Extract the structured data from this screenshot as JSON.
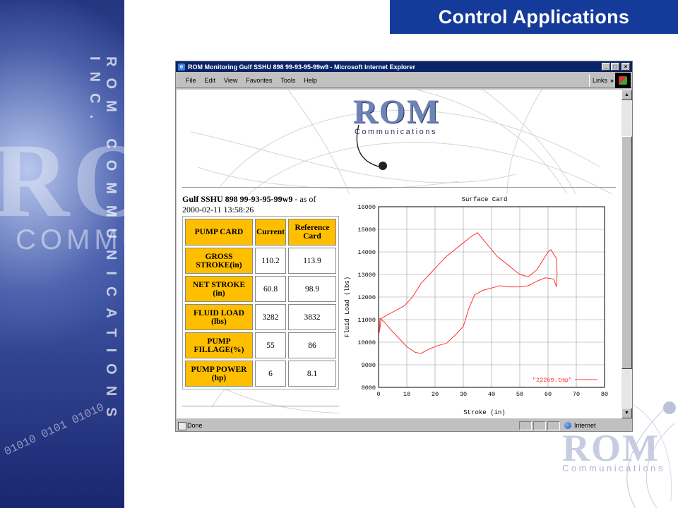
{
  "slide": {
    "title": "Control Applications",
    "left_panel": {
      "big_letters": "ROM",
      "word": "COMMU",
      "vertical_text": "ROM COMMUNICATIONS INC.",
      "binary": "01010 0101 01010"
    },
    "corner_logo": {
      "text": "ROM",
      "sub": "Communications"
    }
  },
  "window": {
    "title": "ROM Monitoring Gulf SSHU 898 99-93-95-99w9 - Microsoft Internet Explorer",
    "menu": [
      "File",
      "Edit",
      "View",
      "Favorites",
      "Tools",
      "Help"
    ],
    "links_label": "Links",
    "links_chevron": "»",
    "controls": {
      "minimize": "_",
      "maximize": "□",
      "close": "×"
    },
    "status": {
      "left": "Done",
      "zone": "Internet"
    }
  },
  "page": {
    "logo": {
      "text": "ROM",
      "sub": "Communications"
    },
    "heading_bold": "Gulf SSHU 898 99-93-95-99w9",
    "heading_rest": " - as of",
    "timestamp": "2000-02-11 13:58:26",
    "table": {
      "headers": [
        "PUMP CARD",
        "Current",
        "Reference Card"
      ],
      "rows": [
        {
          "label": "GROSS STROKE(in)",
          "current": "110.2",
          "reference": "113.9"
        },
        {
          "label": "NET STROKE (in)",
          "current": "60.8",
          "reference": "98.9"
        },
        {
          "label": "FLUID LOAD (lbs)",
          "current": "3282",
          "reference": "3832"
        },
        {
          "label": "PUMP FILLAGE(%)",
          "current": "55",
          "reference": "86"
        },
        {
          "label": "PUMP POWER (hp)",
          "current": "6",
          "reference": "8.1"
        }
      ]
    }
  },
  "chart_data": {
    "type": "line",
    "title": "Surface Card",
    "xlabel": "Stroke (in)",
    "ylabel": "Fluid Load (lbs)",
    "xlim": [
      0,
      80
    ],
    "ylim": [
      8000,
      16000
    ],
    "xticks": [
      0,
      10,
      20,
      30,
      40,
      50,
      60,
      70,
      80
    ],
    "yticks": [
      8000,
      9000,
      10000,
      11000,
      12000,
      13000,
      14000,
      15000,
      16000
    ],
    "grid": true,
    "legend": "bottom-right",
    "series_color": "#ff3333",
    "series": [
      {
        "name": "\"22269.tmp\"",
        "points": [
          [
            0.2,
            10400
          ],
          [
            1,
            11050
          ],
          [
            3,
            11200
          ],
          [
            6,
            11400
          ],
          [
            9,
            11600
          ],
          [
            12,
            12000
          ],
          [
            15,
            12600
          ],
          [
            18,
            13000
          ],
          [
            21,
            13400
          ],
          [
            24,
            13800
          ],
          [
            27,
            14100
          ],
          [
            30,
            14400
          ],
          [
            33,
            14700
          ],
          [
            35,
            14850
          ],
          [
            38,
            14400
          ],
          [
            42,
            13800
          ],
          [
            46,
            13400
          ],
          [
            50,
            13000
          ],
          [
            53,
            12900
          ],
          [
            56,
            13200
          ],
          [
            58,
            13600
          ],
          [
            60,
            14000
          ],
          [
            61,
            14100
          ],
          [
            62,
            13900
          ],
          [
            63,
            13700
          ],
          [
            63.2,
            13000
          ],
          [
            63,
            12450
          ],
          [
            62,
            12800
          ],
          [
            59,
            12850
          ],
          [
            56,
            12700
          ],
          [
            53,
            12500
          ],
          [
            50,
            12450
          ],
          [
            46,
            12450
          ],
          [
            43,
            12500
          ],
          [
            40,
            12400
          ],
          [
            37,
            12300
          ],
          [
            34,
            12100
          ],
          [
            32,
            11500
          ],
          [
            30,
            10700
          ],
          [
            27,
            10300
          ],
          [
            24,
            9950
          ],
          [
            21,
            9850
          ],
          [
            18,
            9700
          ],
          [
            15,
            9500
          ],
          [
            13,
            9550
          ],
          [
            10,
            9800
          ],
          [
            7,
            10200
          ],
          [
            4,
            10600
          ],
          [
            2,
            10900
          ],
          [
            0.5,
            11050
          ],
          [
            0.2,
            10400
          ]
        ]
      }
    ]
  }
}
